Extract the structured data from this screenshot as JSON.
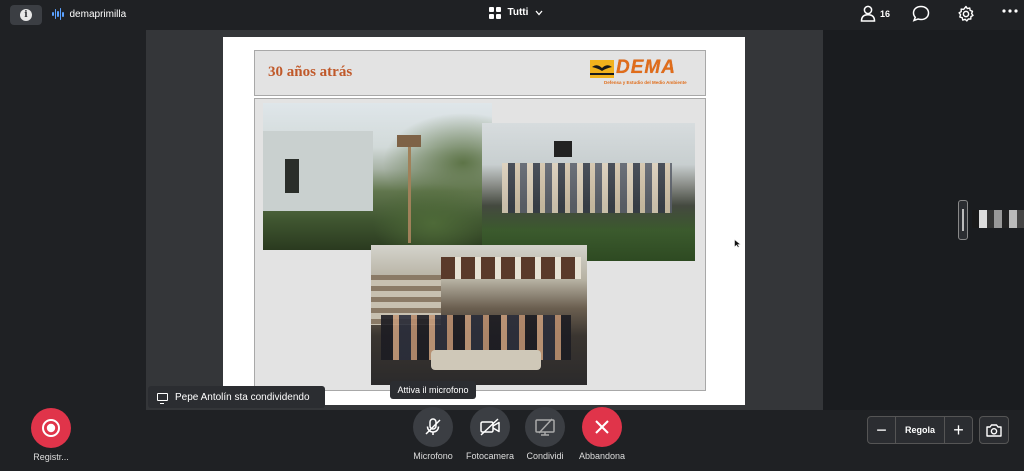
{
  "topbar": {
    "meeting_name": "demaprimilla",
    "view_label": "Tutti",
    "participant_count": "16",
    "icons": [
      "info-icon",
      "audio-wave-icon",
      "grid-icon",
      "chevron-down-icon",
      "person-icon",
      "chat-bubble-icon",
      "gear-icon",
      "more-dots-icon"
    ]
  },
  "slide": {
    "title": "30 años atrás",
    "logo_text": "DEMA",
    "logo_subtitle": "Defensa y Estudio del Medio Ambiente"
  },
  "share_banner": {
    "text": "Pepe Antolín sta condividendo"
  },
  "tooltip": {
    "text": "Attiva il microfono"
  },
  "controls": {
    "record_label": "Registr...",
    "mic_label": "Microfono",
    "camera_label": "Fotocamera",
    "share_label": "Condividi",
    "leave_label": "Abbandona",
    "zoom_label": "Regola",
    "zoom_minus": "−",
    "zoom_plus": "+"
  },
  "colors": {
    "record_red": "#e0344a",
    "leave_red": "#e0344a",
    "control_gray": "#3b3e43",
    "slide_title": "#c0592a",
    "logo_orange": "#e06d1a"
  }
}
